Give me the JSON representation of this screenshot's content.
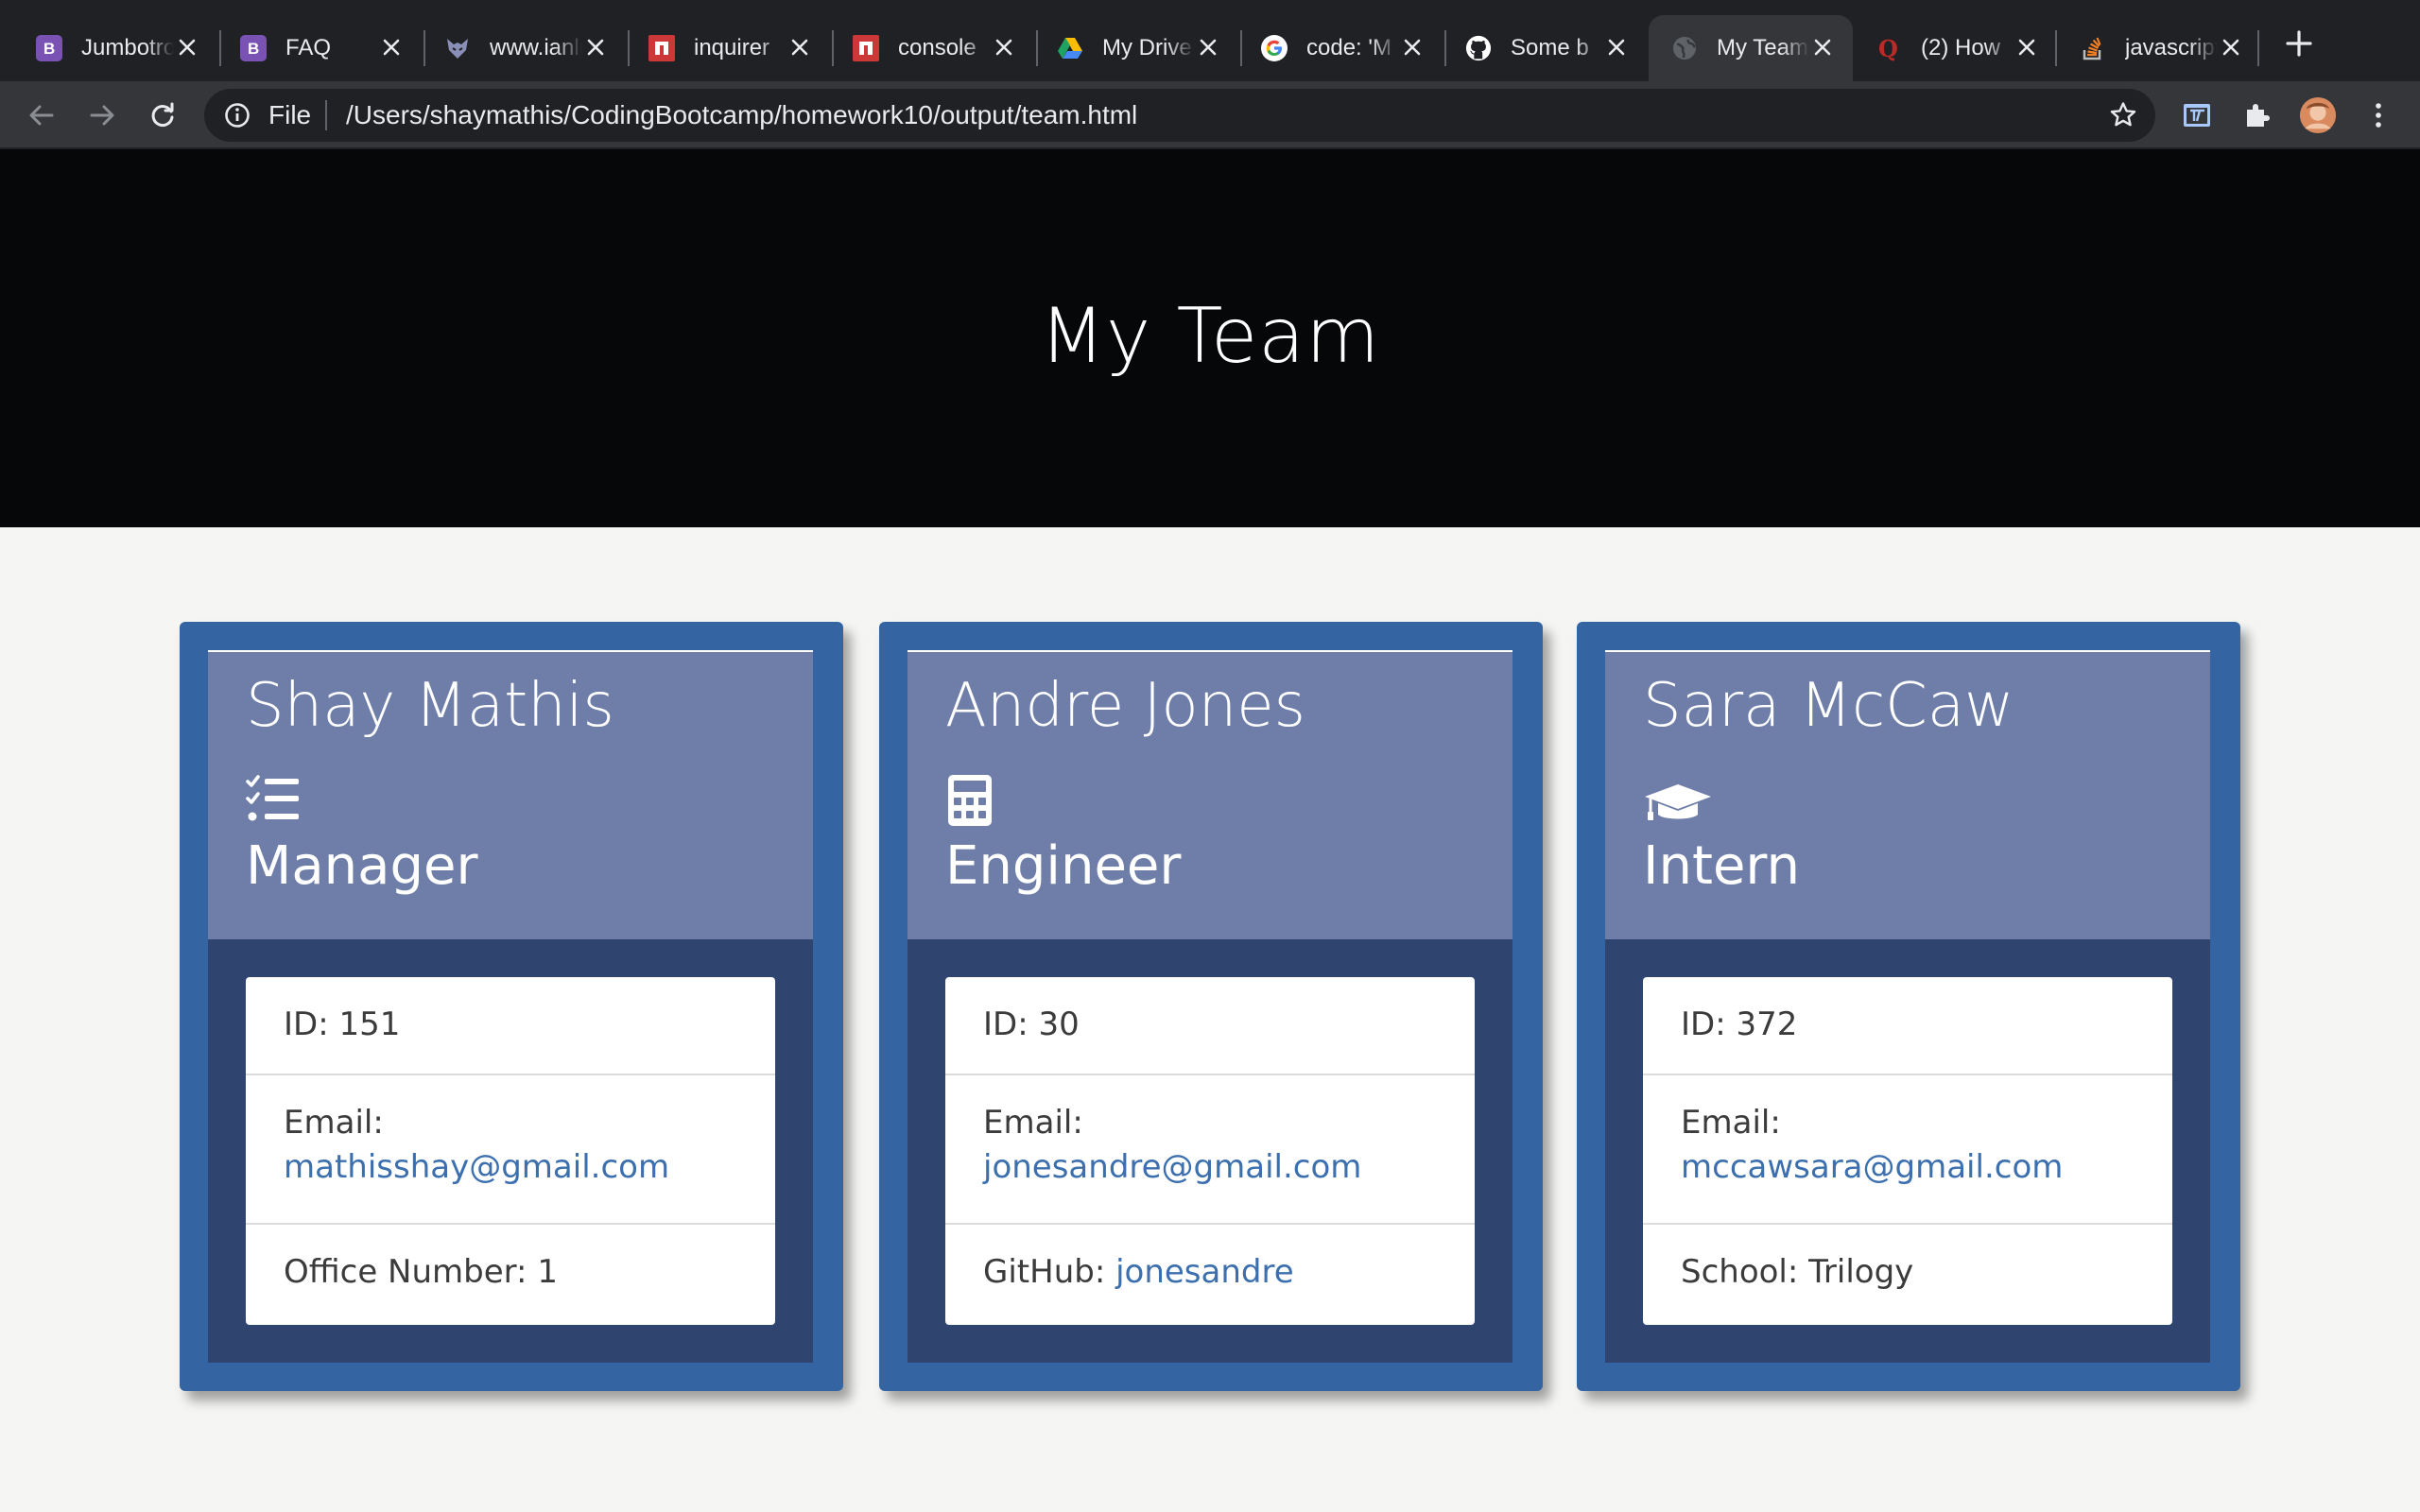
{
  "browser": {
    "tabs": [
      {
        "title": "Jumbotron",
        "icon": "bootstrap-icon",
        "color": "#7952b3"
      },
      {
        "title": "FAQ",
        "icon": "bootstrap-icon",
        "color": "#7952b3"
      },
      {
        "title": "www.ianlunn",
        "icon": "wolf-icon",
        "color": "#8a8fb8"
      },
      {
        "title": "inquirer",
        "icon": "npm-icon",
        "color": "#cb3837"
      },
      {
        "title": "console",
        "icon": "npm-icon",
        "color": "#cb3837"
      },
      {
        "title": "My Drive",
        "icon": "google-drive-icon",
        "color": "#fbbc04"
      },
      {
        "title": "code: 'M",
        "icon": "google-icon",
        "color": "#4285f4"
      },
      {
        "title": "Some b",
        "icon": "github-icon",
        "color": "#ffffff"
      },
      {
        "title": "My Team",
        "icon": "globe-icon",
        "color": "#9aa0a6",
        "active": true
      },
      {
        "title": "(2) How",
        "icon": "quora-icon",
        "color": "#b92b27"
      },
      {
        "title": "javascript",
        "icon": "stackoverflow-icon",
        "color": "#f48024"
      }
    ],
    "address_bar": {
      "scheme_label": "File",
      "url": "/Users/shaymathis/CodingBootcamp/homework10/output/team.html"
    }
  },
  "page": {
    "title": "My Team",
    "members": [
      {
        "name": "Shay Mathis",
        "role": "Manager",
        "role_icon": "tasks-icon",
        "id_label": "ID:",
        "id": "151",
        "email_label": "Email:",
        "email": "mathisshay@gmail.com",
        "extra_label": "Office Number:",
        "extra_value": "1",
        "extra_is_link": false
      },
      {
        "name": "Andre Jones",
        "role": "Engineer",
        "role_icon": "calculator-icon",
        "id_label": "ID:",
        "id": "30",
        "email_label": "Email:",
        "email": "jonesandre@gmail.com",
        "extra_label": "GitHub:",
        "extra_value": "jonesandre",
        "extra_is_link": true
      },
      {
        "name": "Sara McCaw",
        "role": "Intern",
        "role_icon": "graduation-cap-icon",
        "id_label": "ID:",
        "id": "372",
        "email_label": "Email:",
        "email": "mccawsara@gmail.com",
        "extra_label": "School:",
        "extra_value": "Trilogy",
        "extra_is_link": false
      }
    ]
  },
  "colors": {
    "card_outer": "#3464a1",
    "card_inner": "#2f4570",
    "card_header": "#6f7ea8",
    "link": "#3c6fae",
    "jumbotron": "#060709"
  }
}
